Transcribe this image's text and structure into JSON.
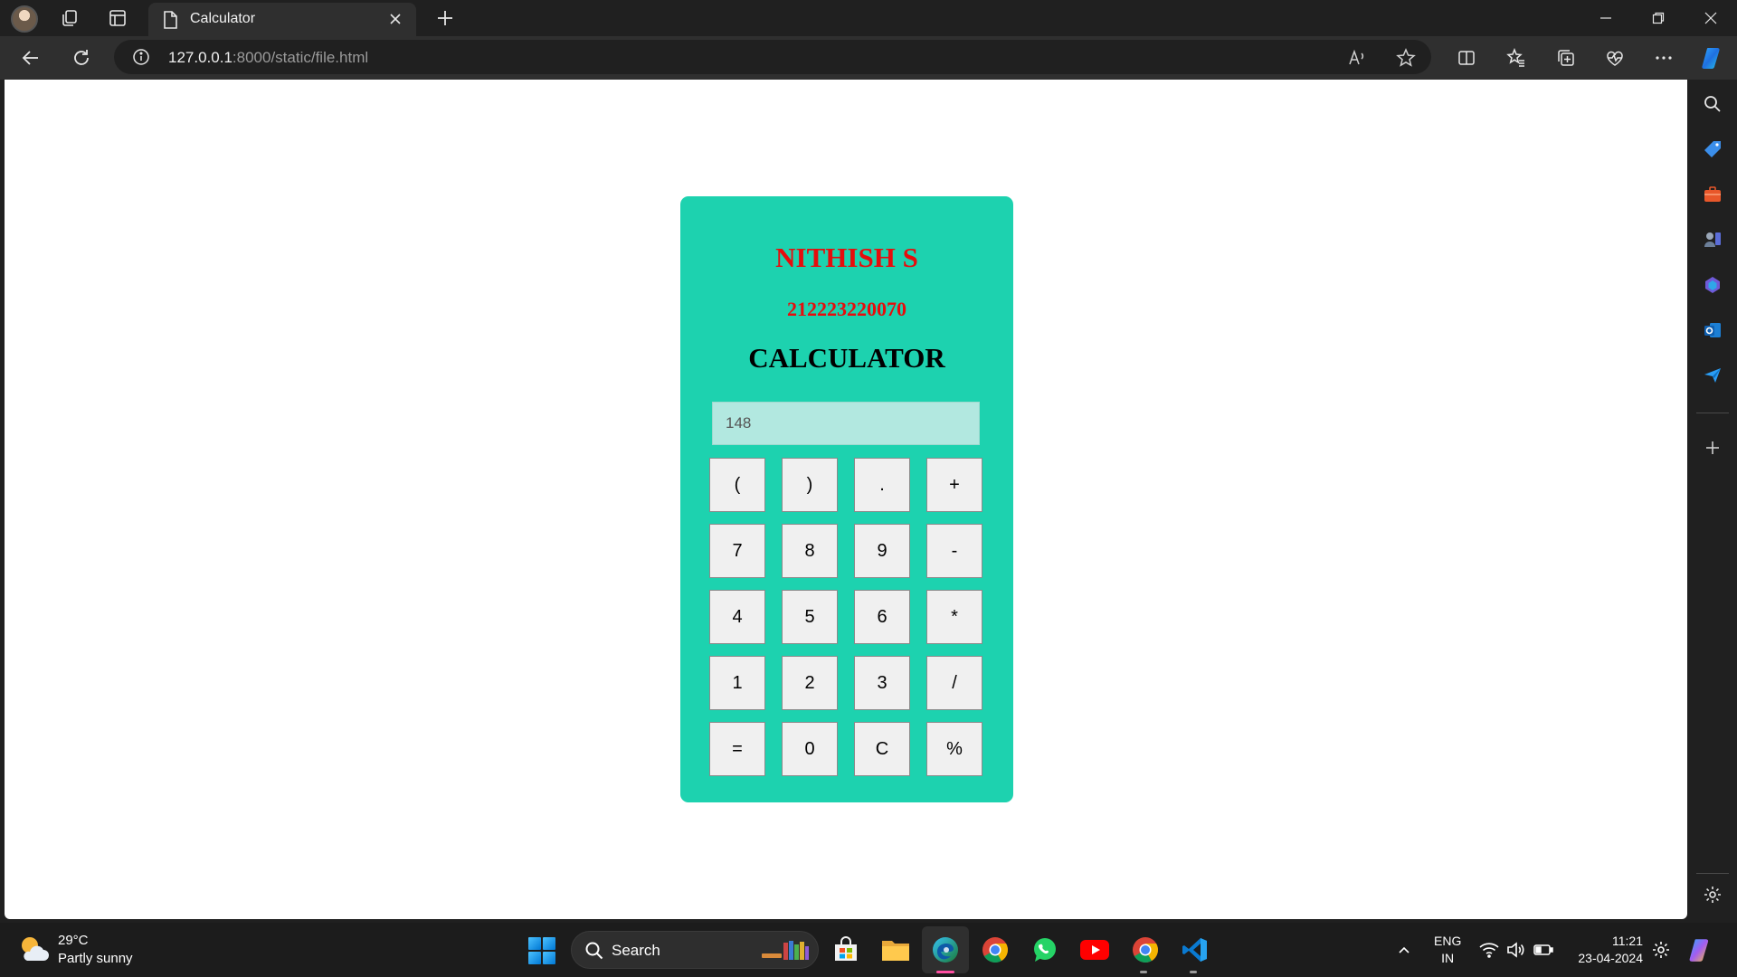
{
  "browser": {
    "tab": {
      "title": "Calculator"
    },
    "address_bar": {
      "host": "127.0.0.1",
      "path": ":8000/static/file.html"
    }
  },
  "page": {
    "name": "NITHISH S",
    "id": "212223220070",
    "title": "CALCULATOR",
    "display_value": "148",
    "keys": [
      "(",
      ")",
      ".",
      "+",
      "7",
      "8",
      "9",
      "-",
      "4",
      "5",
      "6",
      "*",
      "1",
      "2",
      "3",
      "/",
      "=",
      "0",
      "C",
      "%"
    ]
  },
  "taskbar": {
    "weather": {
      "temp": "29°C",
      "desc": "Partly sunny"
    },
    "search_label": "Search",
    "language": {
      "line1": "ENG",
      "line2": "IN"
    },
    "clock": {
      "time": "11:21",
      "date": "23-04-2024"
    }
  },
  "colors": {
    "calculator_bg": "#1dd2af",
    "display_bg": "#b2e8e0",
    "name_red": "#e60d0d",
    "key_bg": "#f0f0f0"
  }
}
